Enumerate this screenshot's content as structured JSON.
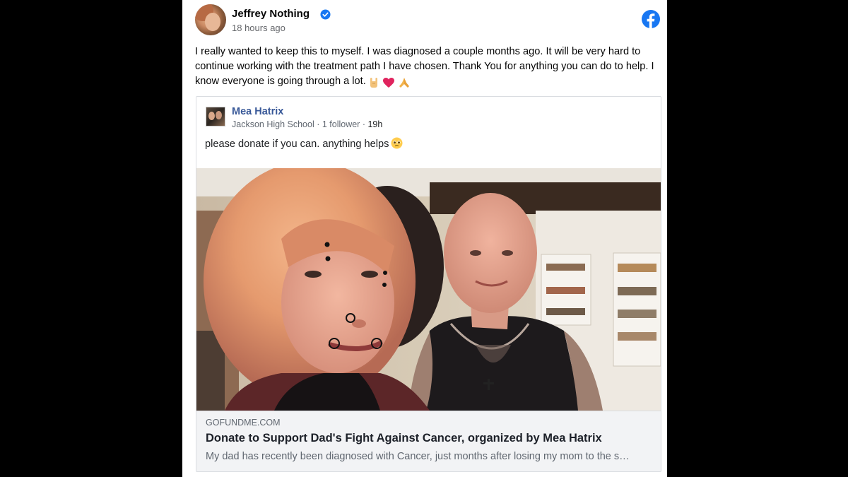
{
  "post": {
    "author_name": "Jeffrey Nothing",
    "timestamp": "18 hours ago",
    "text": "I really wanted to keep this to myself. I was diagnosed a couple months ago. It will be very hard to continue working with the treatment path I have chosen. Thank You for anything you can do to help. I know everyone is going through a lot.",
    "emojis": [
      "sign-of-horns-icon",
      "red-heart-icon",
      "folded-hands-icon"
    ],
    "verified_icon": "verified-badge-icon",
    "brand_icon": "facebook-logo-icon",
    "brand_color": "#1877f2"
  },
  "shared_post": {
    "author_name": "Mea Hatrix",
    "meta_school": "Jackson High School",
    "meta_followers": "1 follower",
    "meta_separator": " · ",
    "meta_time": "19h",
    "text": "please donate if you can. anything helps",
    "emoji": "pleading-face-icon",
    "name_color": "#385898"
  },
  "link_preview": {
    "domain": "GOFUNDME.COM",
    "title": "Donate to Support Dad's Fight Against Cancer, organized by Mea Hatrix",
    "description": "My dad has recently been diagnosed with Cancer, just months after losing my mom to the s…",
    "image": "selfie-photo"
  }
}
